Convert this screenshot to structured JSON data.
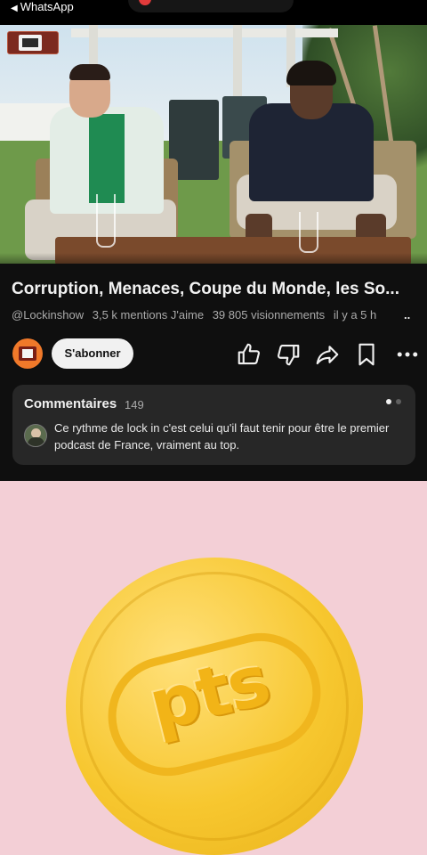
{
  "status_bar": {
    "back_arrow": "◀",
    "back_app": "WhatsApp",
    "record_color": "#e23b3b"
  },
  "video": {
    "watermark_icon": "lockin-logo-icon"
  },
  "title": "Corruption, Menaces, Coupe du Monde, les So...",
  "meta": {
    "channel": "@Lockinshow",
    "likes": "3,5 k mentions J'aime",
    "views": "39 805 visionnements",
    "time": "il y a 5 h",
    "more": ".."
  },
  "actions": {
    "subscribe_label": "S'abonner",
    "icons": [
      "like-icon",
      "dislike-icon",
      "share-icon",
      "save-icon",
      "more-icon"
    ]
  },
  "comments": {
    "title": "Commentaires",
    "count": "149",
    "top_comment": "Ce rythme de lock in c'est celui qu'il faut tenir pour être le premier podcast de France, vraiment au top."
  },
  "ad": {
    "coin_text": "pts",
    "background": "#f3cfd6",
    "coin_color": "#f7c72f"
  }
}
